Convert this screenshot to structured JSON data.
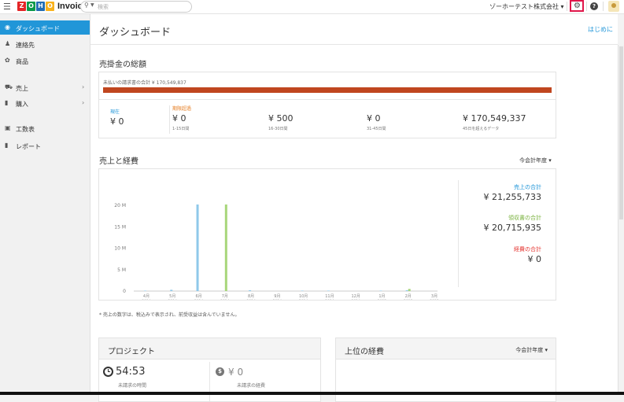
{
  "app": {
    "logo_letters": [
      "Z",
      "O",
      "H",
      "O"
    ],
    "logo_colors": [
      "#e42527",
      "#089949",
      "#226db4",
      "#f9b21d"
    ],
    "name": "Invoice"
  },
  "search": {
    "placeholder": "検索"
  },
  "topbar": {
    "org_name": "ゾーホーテスト株式会社 ▾"
  },
  "sidebar": {
    "items": [
      {
        "label": "ダッシュボード",
        "icon": "dashboard-icon",
        "glyph": "◉",
        "active": true,
        "chevron": ""
      },
      {
        "label": "連絡先",
        "icon": "contacts-icon",
        "glyph": "♟",
        "active": false,
        "chevron": ""
      },
      {
        "label": "商品",
        "icon": "items-icon",
        "glyph": "✿",
        "active": false,
        "chevron": ""
      },
      {
        "label": "売上",
        "icon": "cart-icon",
        "glyph": "⛟",
        "active": false,
        "chevron": "›"
      },
      {
        "label": "購入",
        "icon": "purchase-icon",
        "glyph": "▮",
        "active": false,
        "chevron": "›"
      },
      {
        "label": "工数表",
        "icon": "timesheet-icon",
        "glyph": "▣",
        "active": false,
        "chevron": ""
      },
      {
        "label": "レポート",
        "icon": "reports-icon",
        "glyph": "▮",
        "active": false,
        "chevron": ""
      }
    ]
  },
  "header": {
    "title": "ダッシュボード",
    "get_started": "はじめに"
  },
  "receivables": {
    "title": "売掛金の総額",
    "unpaid_label": "未払いの請求書の合計 ¥ 170,549,837",
    "unpaid_ratio": 1.0,
    "current": {
      "label": "現在",
      "amount": "¥ 0"
    },
    "overdue_label": "期限超過",
    "buckets": [
      {
        "amount": "¥ 0",
        "range": "1-15日間"
      },
      {
        "amount": "¥ 500",
        "range": "16-30日間"
      },
      {
        "amount": "¥ 0",
        "range": "31-45日間"
      },
      {
        "amount": "¥ 170,549,337",
        "range": "45日を超えるデータ"
      }
    ]
  },
  "sales_expenses": {
    "title": "売上と経費",
    "period": "今会計年度 ▾",
    "totals": [
      {
        "label": "売上の合計",
        "value": "¥ 21,255,733",
        "color": "#2196d8"
      },
      {
        "label": "領収書の合計",
        "value": "¥ 20,715,935",
        "color": "#7cb342"
      },
      {
        "label": "経費の合計",
        "value": "¥ 0",
        "color": "#e53935"
      }
    ],
    "footnote": "* 売上の数字は、税込みで表示され、前受収益は含んでいません。"
  },
  "chart_data": {
    "type": "bar",
    "categories": [
      "4月\n2014",
      "5月\n2014",
      "6月\n2014",
      "7月\n2014",
      "8月\n2014",
      "9月\n2014",
      "10月\n2014",
      "11月\n2014",
      "12月\n2014",
      "1月\n2015",
      "2月\n2015",
      "3月\n2015"
    ],
    "series": [
      {
        "name": "売上の合計",
        "color": "#8fc9ea",
        "values": [
          0.1,
          0.3,
          20.2,
          0,
          0.2,
          0,
          0.1,
          0.1,
          0,
          0.1,
          0.2,
          0
        ]
      },
      {
        "name": "領収書の合計",
        "color": "#a8d67a",
        "values": [
          0,
          0,
          0,
          20.2,
          0,
          0,
          0,
          0,
          0,
          0,
          0.5,
          0
        ]
      }
    ],
    "yticks": [
      "0",
      "5 M",
      "10 M",
      "15 M",
      "20 M"
    ],
    "ylim": [
      0,
      20
    ],
    "unit": "M"
  },
  "projects": {
    "title": "プロジェクト",
    "unbilled_hours": "54:53",
    "unbilled_hours_label": "未請求の時間",
    "unbilled_expense": "¥ 0",
    "unbilled_expense_label": "未請求の経費"
  },
  "top_expenses": {
    "title": "上位の経費",
    "period": "今会計年度 ▾"
  }
}
